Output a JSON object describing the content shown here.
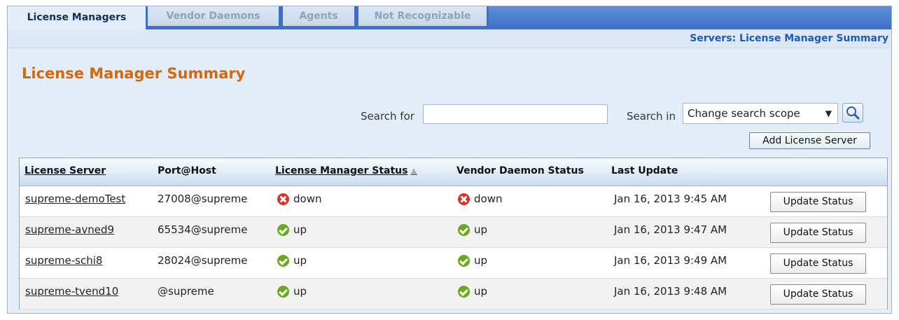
{
  "tabs": [
    {
      "label": "License Managers",
      "active": true
    },
    {
      "label": "Vendor Daemons",
      "active": false
    },
    {
      "label": "Agents",
      "active": false
    },
    {
      "label": "Not Recognizable",
      "active": false
    }
  ],
  "breadcrumb": "Servers:  License Manager Summary",
  "page_title": "License Manager Summary",
  "search": {
    "label": "Search for",
    "value": "",
    "placeholder": "",
    "scope_label": "Search in",
    "scope_value": "Change search scope",
    "search_icon": "magnifier-icon"
  },
  "add_button": "Add License Server",
  "table": {
    "columns": [
      "License Server",
      "Port@Host",
      "License Manager Status",
      "Vendor Daemon Status",
      "Last Update"
    ],
    "sort_icon": "▲",
    "rows": [
      {
        "server": "supreme-demoTest",
        "port_host": "27008@supreme",
        "lm_status": "down",
        "vd_status": "down",
        "last_update": "Jan 16, 2013 9:45 AM",
        "action": "Update Status"
      },
      {
        "server": "supreme-avned9",
        "port_host": "65534@supreme",
        "lm_status": "up",
        "vd_status": "up",
        "last_update": "Jan 16, 2013 9:47 AM",
        "action": "Update Status"
      },
      {
        "server": "supreme-schi8",
        "port_host": "28024@supreme",
        "lm_status": "up",
        "vd_status": "up",
        "last_update": "Jan 16, 2013 9:49 AM",
        "action": "Update Status"
      },
      {
        "server": "supreme-tvend10",
        "port_host": "@supreme",
        "lm_status": "up",
        "vd_status": "up",
        "last_update": "Jan 16, 2013 9:48 AM",
        "action": "Update Status"
      }
    ]
  },
  "colors": {
    "title": "#d2690f",
    "tabstrip": "#3d6fc6",
    "breadcrumb": "#1c5bb8",
    "status_up": "#6aaa1e",
    "status_down": "#d8322a"
  }
}
